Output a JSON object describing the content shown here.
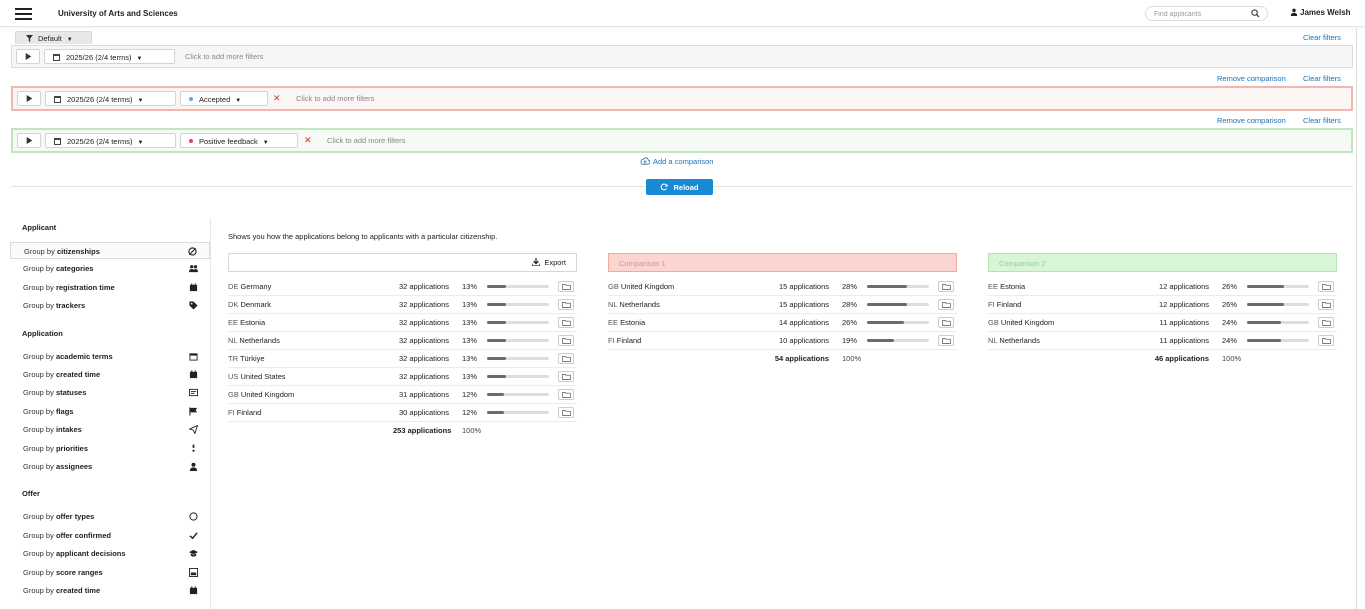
{
  "header": {
    "app_title": "University of Arts and Sciences",
    "search_placeholder": "Find applicants",
    "user_name": "James Welsh"
  },
  "filters": {
    "preset_label": "Default",
    "clear_filters": "Clear filters",
    "remove_comparison": "Remove comparison",
    "add_more_filters": "Click to add more filters",
    "term_chip": "2025/26 (2/4 terms)",
    "comparison1_filter": "Accepted",
    "comparison2_filter": "Positive feedback",
    "add_comparison": "Add a comparison",
    "reload": "Reload",
    "colors": {
      "comparison1_border": "#f2b6b0",
      "comparison2_border": "#bfe6bc",
      "accepted_dot": "#5aa7e8",
      "positive_dot": "#e0417a",
      "accent": "#1a8ad4"
    }
  },
  "sidebar": {
    "sections": [
      {
        "title": "Applicant",
        "items": [
          {
            "prefix": "Group by ",
            "label": "citizenships",
            "icon": "eye-slash-icon",
            "active": true
          },
          {
            "prefix": "Group by ",
            "label": "categories",
            "icon": "users-icon"
          },
          {
            "prefix": "Group by ",
            "label": "registration time",
            "icon": "calendar-icon"
          },
          {
            "prefix": "Group by ",
            "label": "trackers",
            "icon": "tag-icon"
          }
        ]
      },
      {
        "title": "Application",
        "items": [
          {
            "prefix": "Group by ",
            "label": "academic terms",
            "icon": "calendar-outline-icon"
          },
          {
            "prefix": "Group by ",
            "label": "created time",
            "icon": "calendar-icon"
          },
          {
            "prefix": "Group by ",
            "label": "statuses",
            "icon": "status-icon"
          },
          {
            "prefix": "Group by ",
            "label": "flags",
            "icon": "flag-icon"
          },
          {
            "prefix": "Group by ",
            "label": "intakes",
            "icon": "paper-plane-icon"
          },
          {
            "prefix": "Group by ",
            "label": "priorities",
            "icon": "priority-icon"
          },
          {
            "prefix": "Group by ",
            "label": "assignees",
            "icon": "user-icon"
          }
        ]
      },
      {
        "title": "Offer",
        "items": [
          {
            "prefix": "Group by ",
            "label": "offer types",
            "icon": "circle-icon"
          },
          {
            "prefix": "Group by ",
            "label": "offer confirmed",
            "icon": "check-icon"
          },
          {
            "prefix": "Group by ",
            "label": "applicant decisions",
            "icon": "graduation-cap-icon"
          },
          {
            "prefix": "Group by ",
            "label": "score ranges",
            "icon": "score-icon"
          },
          {
            "prefix": "Group by ",
            "label": "created time",
            "icon": "calendar-icon"
          }
        ]
      }
    ]
  },
  "content": {
    "description": "Shows you how the applications belong to applicants with a particular citizenship.",
    "export_label": "Export",
    "comparison1_title": "Comparison 1",
    "comparison2_title": "Comparison 2",
    "main": {
      "rows": [
        {
          "code": "DE",
          "country": "Germany",
          "count": "32 applications",
          "pct": "13%",
          "fraction": 0.13
        },
        {
          "code": "DK",
          "country": "Denmark",
          "count": "32 applications",
          "pct": "13%",
          "fraction": 0.13
        },
        {
          "code": "EE",
          "country": "Estonia",
          "count": "32 applications",
          "pct": "13%",
          "fraction": 0.13
        },
        {
          "code": "NL",
          "country": "Netherlands",
          "count": "32 applications",
          "pct": "13%",
          "fraction": 0.13
        },
        {
          "code": "TR",
          "country": "Türkiye",
          "count": "32 applications",
          "pct": "13%",
          "fraction": 0.13
        },
        {
          "code": "US",
          "country": "United States",
          "count": "32 applications",
          "pct": "13%",
          "fraction": 0.13
        },
        {
          "code": "GB",
          "country": "United Kingdom",
          "count": "31 applications",
          "pct": "12%",
          "fraction": 0.12
        },
        {
          "code": "FI",
          "country": "Finland",
          "count": "30 applications",
          "pct": "12%",
          "fraction": 0.12
        }
      ],
      "total_count": "253 applications",
      "total_pct": "100%"
    },
    "comparison1": {
      "rows": [
        {
          "code": "GB",
          "country": "United Kingdom",
          "count": "15 applications",
          "pct": "28%",
          "fraction": 0.28
        },
        {
          "code": "NL",
          "country": "Netherlands",
          "count": "15 applications",
          "pct": "28%",
          "fraction": 0.28
        },
        {
          "code": "EE",
          "country": "Estonia",
          "count": "14 applications",
          "pct": "26%",
          "fraction": 0.26
        },
        {
          "code": "FI",
          "country": "Finland",
          "count": "10 applications",
          "pct": "19%",
          "fraction": 0.19
        }
      ],
      "total_count": "54 applications",
      "total_pct": "100%"
    },
    "comparison2": {
      "rows": [
        {
          "code": "EE",
          "country": "Estonia",
          "count": "12 applications",
          "pct": "26%",
          "fraction": 0.26
        },
        {
          "code": "FI",
          "country": "Finland",
          "count": "12 applications",
          "pct": "26%",
          "fraction": 0.26
        },
        {
          "code": "GB",
          "country": "United Kingdom",
          "count": "11 applications",
          "pct": "24%",
          "fraction": 0.24
        },
        {
          "code": "NL",
          "country": "Netherlands",
          "count": "11 applications",
          "pct": "24%",
          "fraction": 0.24
        }
      ],
      "total_count": "46 applications",
      "total_pct": "100%"
    }
  }
}
